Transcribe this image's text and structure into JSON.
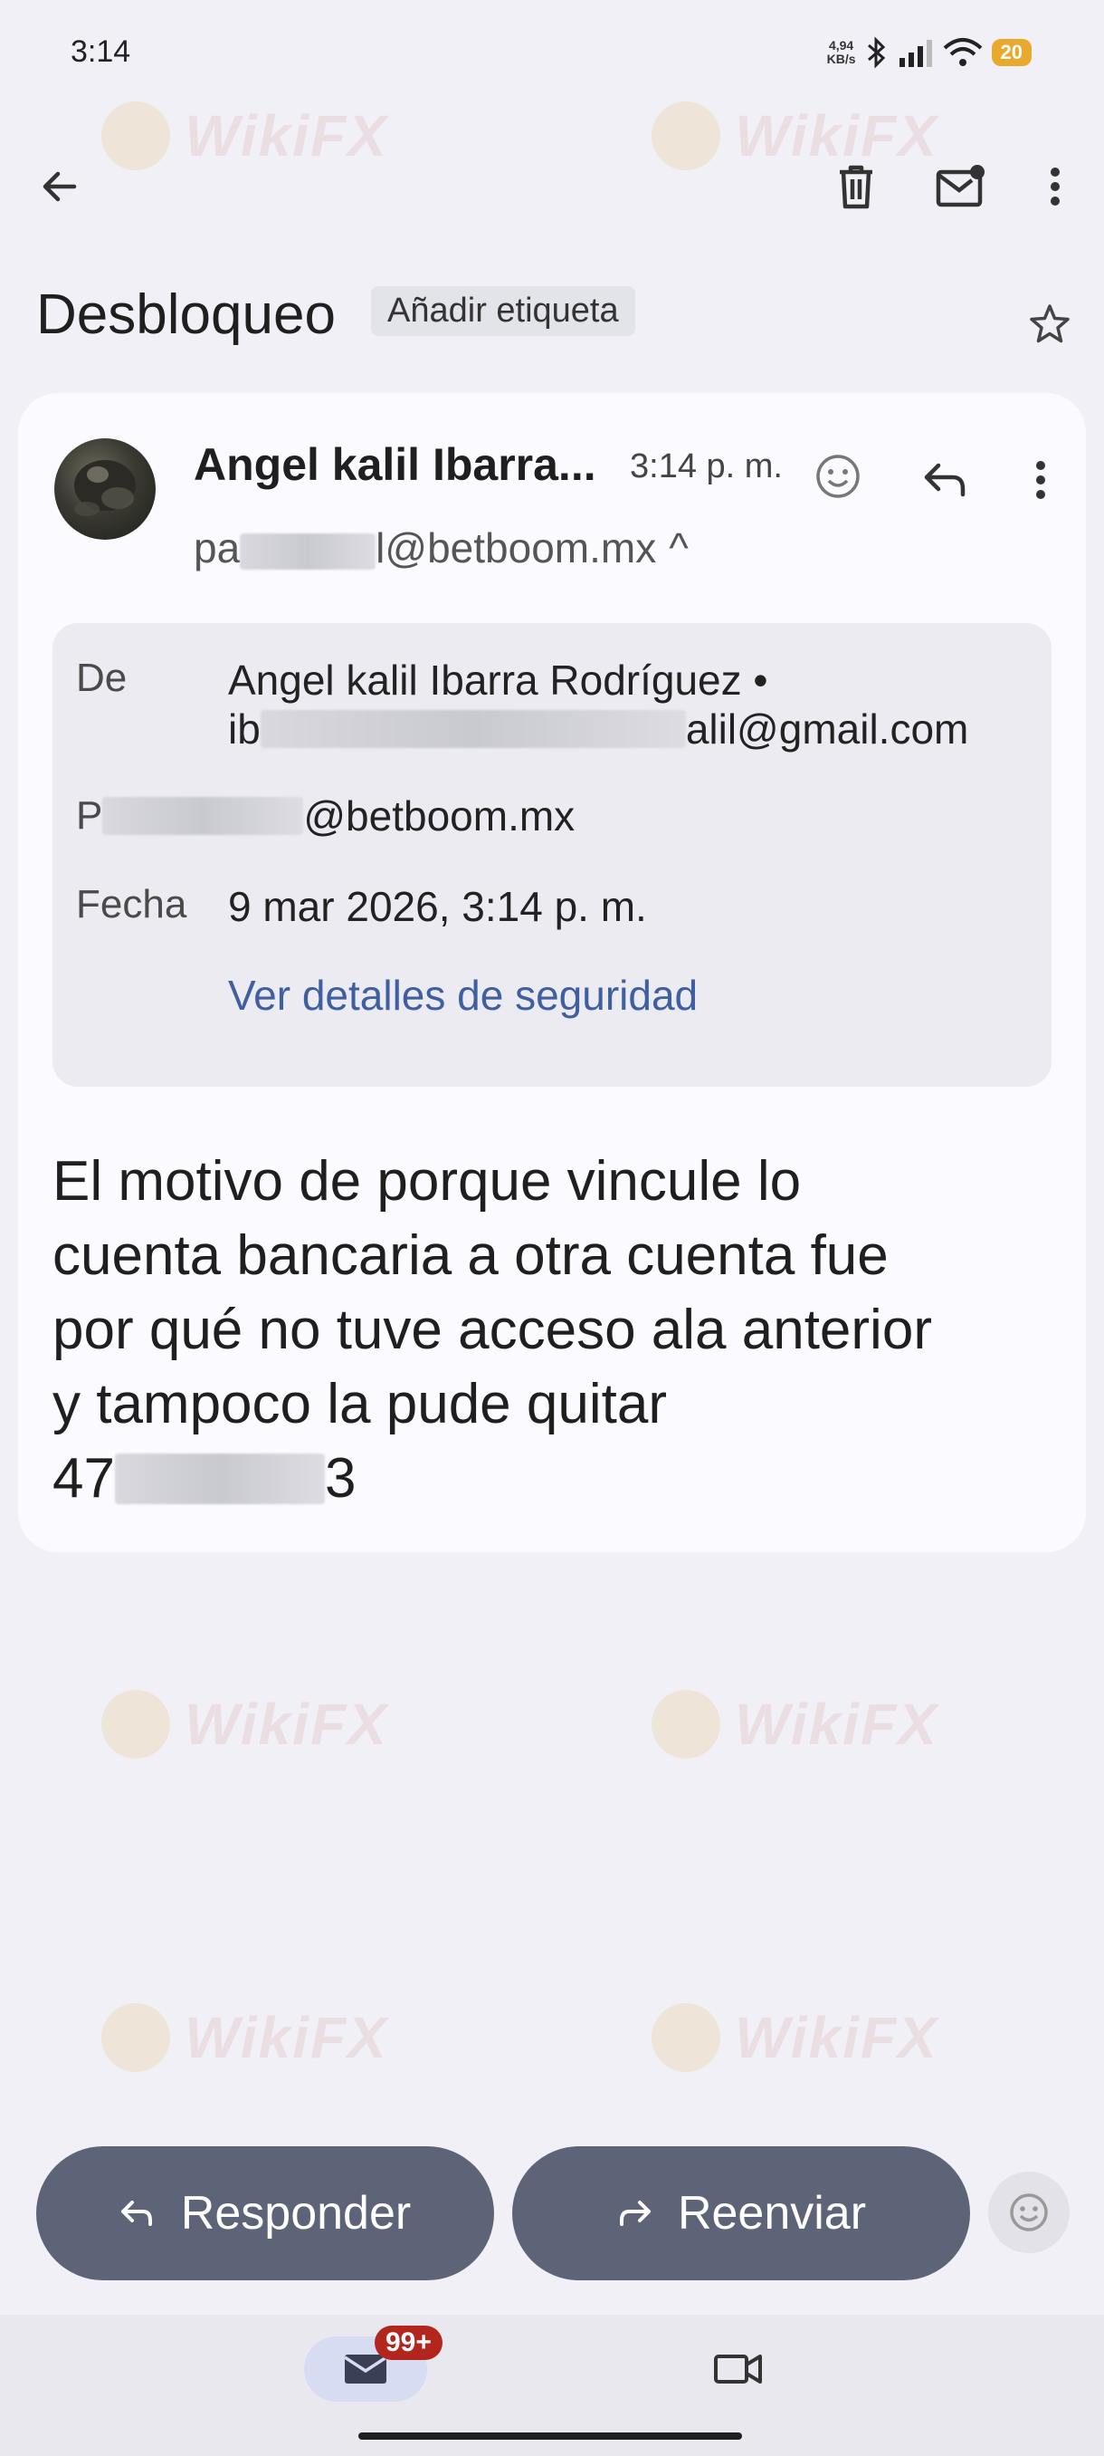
{
  "status_bar": {
    "time": "3:14",
    "net_speed_value": "4,94",
    "net_speed_unit": "KB/s",
    "battery": "20"
  },
  "toolbar": {
    "back_icon": "arrow-back-icon",
    "delete_icon": "trash-icon",
    "mark_unread_icon": "mail-unread-icon",
    "more_icon": "more-vertical-icon"
  },
  "email": {
    "subject": "Desbloqueo",
    "add_label": "Añadir etiqueta",
    "sender_name": "Angel kalil Ibarra...",
    "time": "3:14 p. m.",
    "recipient_prefix": "pa",
    "recipient_suffix": "l@betboom.mx",
    "recipient_toggle": "^",
    "details": {
      "from_label": "De",
      "from_name": "Angel kalil Ibarra Rodríguez •",
      "from_email_prefix": "ib",
      "from_email_suffix": "alil@gmail.com",
      "to_label_prefix": "P",
      "to_email_suffix": "@betboom.mx",
      "date_label": "Fecha",
      "date_value": "9 mar 2026, 3:14 p. m.",
      "security_link": "Ver detalles de seguridad"
    },
    "body_lines": [
      "El motivo de porque vincule lo",
      "cuenta bancaria a otra cuenta fue",
      "por qué no tuve acceso ala anterior",
      "y tampoco la pude quitar"
    ],
    "body_number_prefix": "47",
    "body_number_suffix": "3"
  },
  "actions": {
    "reply_label": "Responder",
    "forward_label": "Reenviar"
  },
  "bottom_nav": {
    "mail_badge": "99+"
  },
  "watermark": "WikiFX",
  "colors": {
    "action_button": "#5e6478",
    "link": "#3f5fa0",
    "badge": "#b3261e",
    "battery": "#e8a92c"
  }
}
